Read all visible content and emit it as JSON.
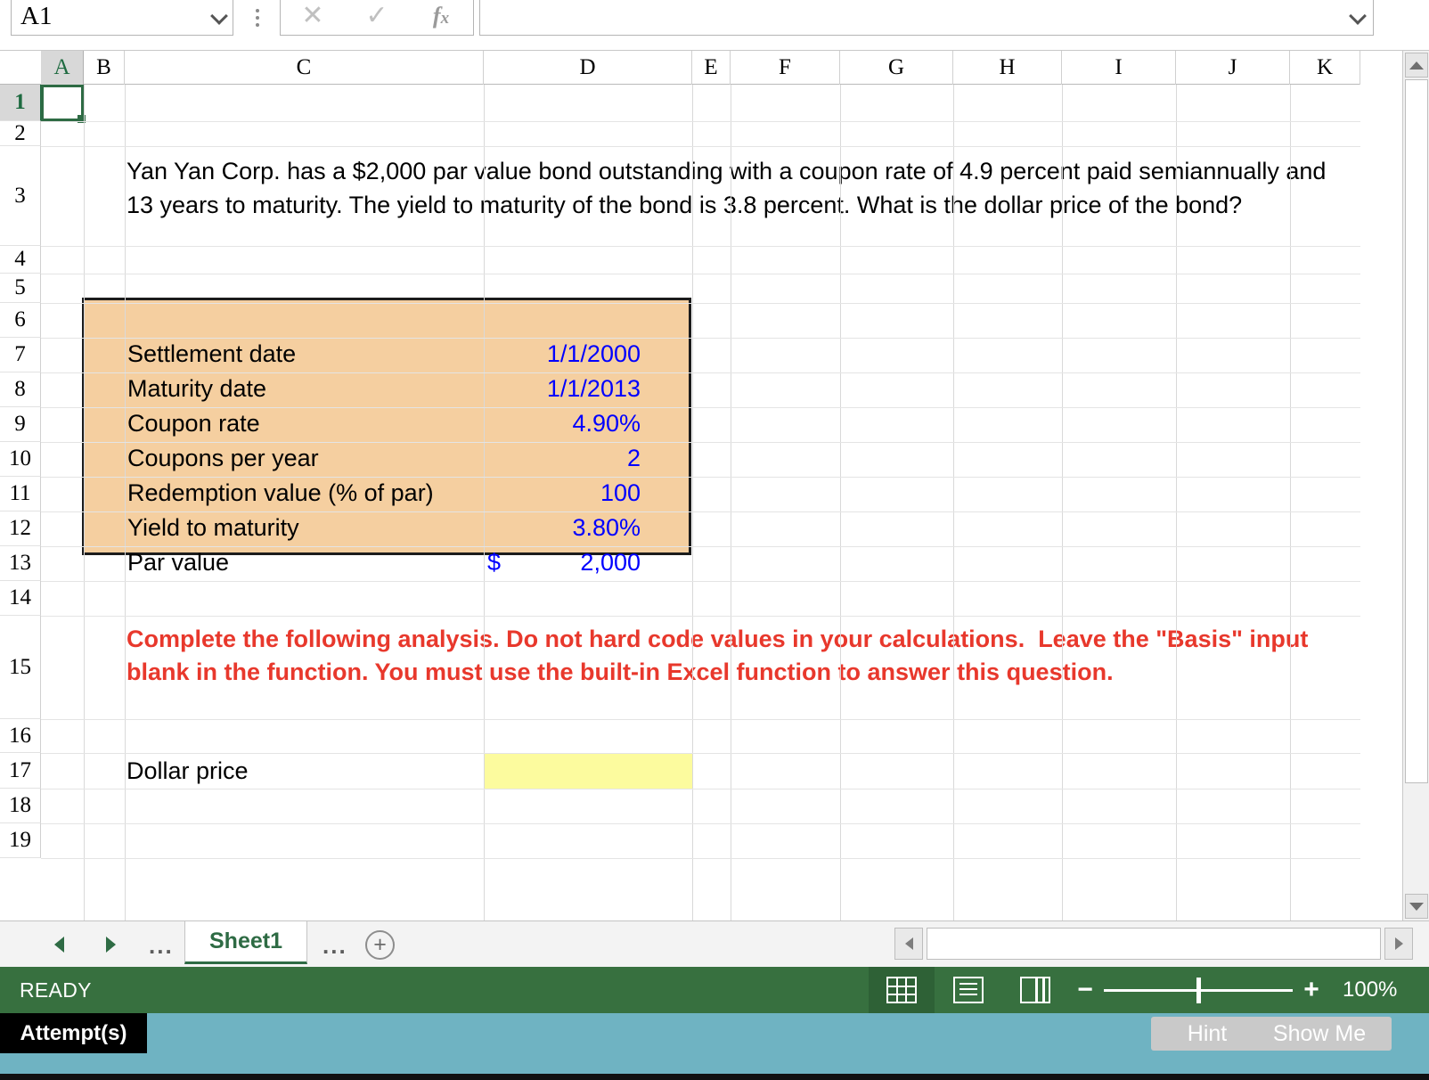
{
  "name_box": {
    "value": "A1",
    "dropdown_icon": "chevron-down-icon"
  },
  "formula_bar": {
    "cancel_icon": "cancel-x-icon",
    "accept_icon": "check-icon",
    "function_icon": "fx-insert-function-icon",
    "value": "",
    "expand_icon": "chevron-down-icon"
  },
  "grid": {
    "columns": [
      "A",
      "B",
      "C",
      "D",
      "E",
      "F",
      "G",
      "H",
      "I",
      "J",
      "K"
    ],
    "rows": [
      "1",
      "2",
      "3",
      "4",
      "5",
      "6",
      "7",
      "8",
      "9",
      "10",
      "11",
      "12",
      "13",
      "14",
      "15",
      "16",
      "17",
      "18",
      "19"
    ],
    "selected_cell": "A1"
  },
  "question": "Yan Yan Corp. has a $2,000 par value bond outstanding with a coupon rate of 4.9 percent paid semiannually and 13 years to maturity. The yield to maturity of the bond is 3.8 percent. What is the dollar price of the bond?",
  "assumptions": {
    "fill_color": "#F5CFA0",
    "value_color": "#0000FF",
    "rows": [
      {
        "label": "Settlement date",
        "symbol": "",
        "value": "1/1/2000"
      },
      {
        "label": "Maturity date",
        "symbol": "",
        "value": "1/1/2013"
      },
      {
        "label": "Coupon rate",
        "symbol": "",
        "value": "4.90%"
      },
      {
        "label": "Coupons per year",
        "symbol": "",
        "value": "2"
      },
      {
        "label": "Redemption value (% of par)",
        "symbol": "",
        "value": "100"
      },
      {
        "label": "Yield to maturity",
        "symbol": "",
        "value": "3.80%"
      },
      {
        "label": "Par value",
        "symbol": "$",
        "value": "2,000"
      }
    ]
  },
  "instructions": {
    "text": "Complete the following analysis. Do not hard code values in your calculations.  Leave the \"Basis\" input blank in the function. You must use the built-in Excel function to answer this question.",
    "color": "#E8382C"
  },
  "answer": {
    "label": "Dollar price",
    "value": "",
    "fill_color": "#FCFB9E"
  },
  "sheet_tabs": {
    "first_icon": "nav-first-arrow-icon",
    "prev_icon": "nav-prev-arrow-icon",
    "left_ellipsis": "...",
    "active_tab": "Sheet1",
    "right_ellipsis": "...",
    "add_sheet_icon": "add-sheet-plus-icon"
  },
  "status_bar": {
    "state": "READY",
    "views": [
      {
        "name": "normal-view-icon",
        "active": true
      },
      {
        "name": "page-layout-view-icon",
        "active": false
      },
      {
        "name": "page-break-view-icon",
        "active": false
      }
    ],
    "zoom_out_icon": "minus-icon",
    "zoom_in_icon": "plus-icon",
    "zoom_level": "100%"
  },
  "attempt_bar": {
    "label": "Attempt(s)",
    "hint_button": "Hint",
    "show_me_button": "Show Me"
  }
}
